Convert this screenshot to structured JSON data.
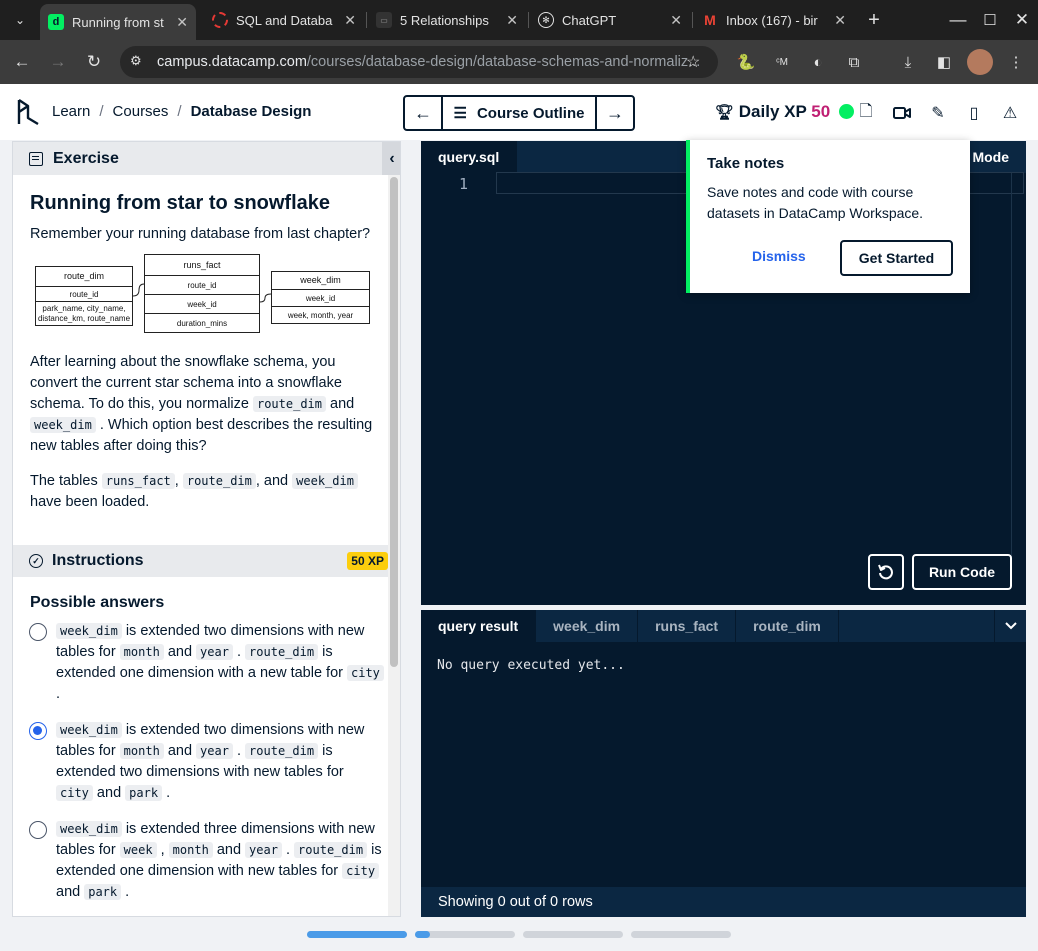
{
  "browser": {
    "tabs": [
      {
        "title": "Running from st",
        "icon": "datacamp-icon",
        "active": true
      },
      {
        "title": "SQL and Databa",
        "icon": "loading-ring-icon",
        "active": false
      },
      {
        "title": "5 Relationships",
        "icon": "site-icon",
        "active": false
      },
      {
        "title": "ChatGPT",
        "icon": "chatgpt-icon",
        "active": false
      },
      {
        "title": "Inbox (167) - bir",
        "icon": "gmail-icon",
        "active": false
      }
    ],
    "url_host": "campus.datacamp.com",
    "url_path": "/courses/database-design/database-schemas-and-normaliz..."
  },
  "header": {
    "crumbs": [
      "Learn",
      "Courses",
      "Database Design"
    ],
    "outline_label": "Course Outline",
    "daily_xp_label": "Daily XP",
    "daily_xp_value": "50"
  },
  "exercise": {
    "section_label": "Exercise",
    "title": "Running from star to snowflake",
    "intro": "Remember your running database from last chapter?",
    "schema": {
      "route_dim": {
        "name": "route_dim",
        "rows": [
          "route_id",
          "park_name, city_name,",
          "distance_km, route_name"
        ]
      },
      "runs_fact": {
        "name": "runs_fact",
        "rows": [
          "route_id",
          "week_id",
          "duration_mins"
        ]
      },
      "week_dim": {
        "name": "week_dim",
        "rows": [
          "week_id",
          "week, month, year"
        ]
      }
    },
    "p1_a": "After learning about the snowflake schema, you convert the current star schema into a snowflake schema. To do this, you normalize ",
    "p1_code1": "route_dim",
    "p1_b": " and ",
    "p1_code2": "week_dim",
    "p1_c": " . Which option best describes the resulting new tables after doing this?",
    "p2_a": "The tables ",
    "p2_code1": "runs_fact",
    "p2_b": ", ",
    "p2_code2": "route_dim",
    "p2_c": ", and ",
    "p2_code3": "week_dim",
    "p2_d": " have been loaded."
  },
  "instructions": {
    "label": "Instructions",
    "xp": "50 XP",
    "possible_answers": "Possible answers"
  },
  "answers": [
    {
      "selected": false,
      "parts": [
        [
          "code",
          "week_dim"
        ],
        [
          "t",
          " is extended two dimensions with new tables for "
        ],
        [
          "code",
          "month"
        ],
        [
          "t",
          " and "
        ],
        [
          "code",
          "year"
        ],
        [
          "t",
          " . "
        ],
        [
          "code",
          "route_dim"
        ],
        [
          "t",
          " is extended one dimension with a new table for "
        ],
        [
          "code",
          "city"
        ],
        [
          "t",
          " ."
        ]
      ]
    },
    {
      "selected": true,
      "parts": [
        [
          "code",
          "week_dim"
        ],
        [
          "t",
          " is extended two dimensions with new tables for "
        ],
        [
          "code",
          "month"
        ],
        [
          "t",
          " and "
        ],
        [
          "code",
          "year"
        ],
        [
          "t",
          " . "
        ],
        [
          "code",
          "route_dim"
        ],
        [
          "t",
          " is extended two dimensions with new tables for "
        ],
        [
          "code",
          "city"
        ],
        [
          "t",
          " and "
        ],
        [
          "code",
          "park"
        ],
        [
          "t",
          " ."
        ]
      ]
    },
    {
      "selected": false,
      "parts": [
        [
          "code",
          "week_dim"
        ],
        [
          "t",
          " is extended three dimensions with new tables for "
        ],
        [
          "code",
          "week"
        ],
        [
          "t",
          " , "
        ],
        [
          "code",
          "month"
        ],
        [
          "t",
          " and "
        ],
        [
          "code",
          "year"
        ],
        [
          "t",
          " . "
        ],
        [
          "code",
          "route_dim"
        ],
        [
          "t",
          " is extended one dimension with new tables for "
        ],
        [
          "code",
          "city"
        ],
        [
          "t",
          " and "
        ],
        [
          "code",
          "park"
        ],
        [
          "t",
          " ."
        ]
      ]
    }
  ],
  "editor": {
    "tab": "query.sql",
    "mode_label": "Mode",
    "line_number": "1",
    "run_label": "Run Code"
  },
  "popup": {
    "title": "Take notes",
    "body": "Save notes and code with course datasets in DataCamp Workspace.",
    "dismiss": "Dismiss",
    "get_started": "Get Started"
  },
  "output": {
    "tabs": [
      "query result",
      "week_dim",
      "runs_fact",
      "route_dim"
    ],
    "message": "No query executed yet...",
    "footer": "Showing 0 out of 0 rows"
  },
  "colors": {
    "brand_green": "#03ef62",
    "editor_bg": "#05192d",
    "xp_pink": "#c01f73",
    "badge_yellow": "#fcce0d",
    "radio_blue": "#2563eb"
  },
  "progress_segments": [
    1.0,
    0.15,
    0.0,
    0.0
  ]
}
